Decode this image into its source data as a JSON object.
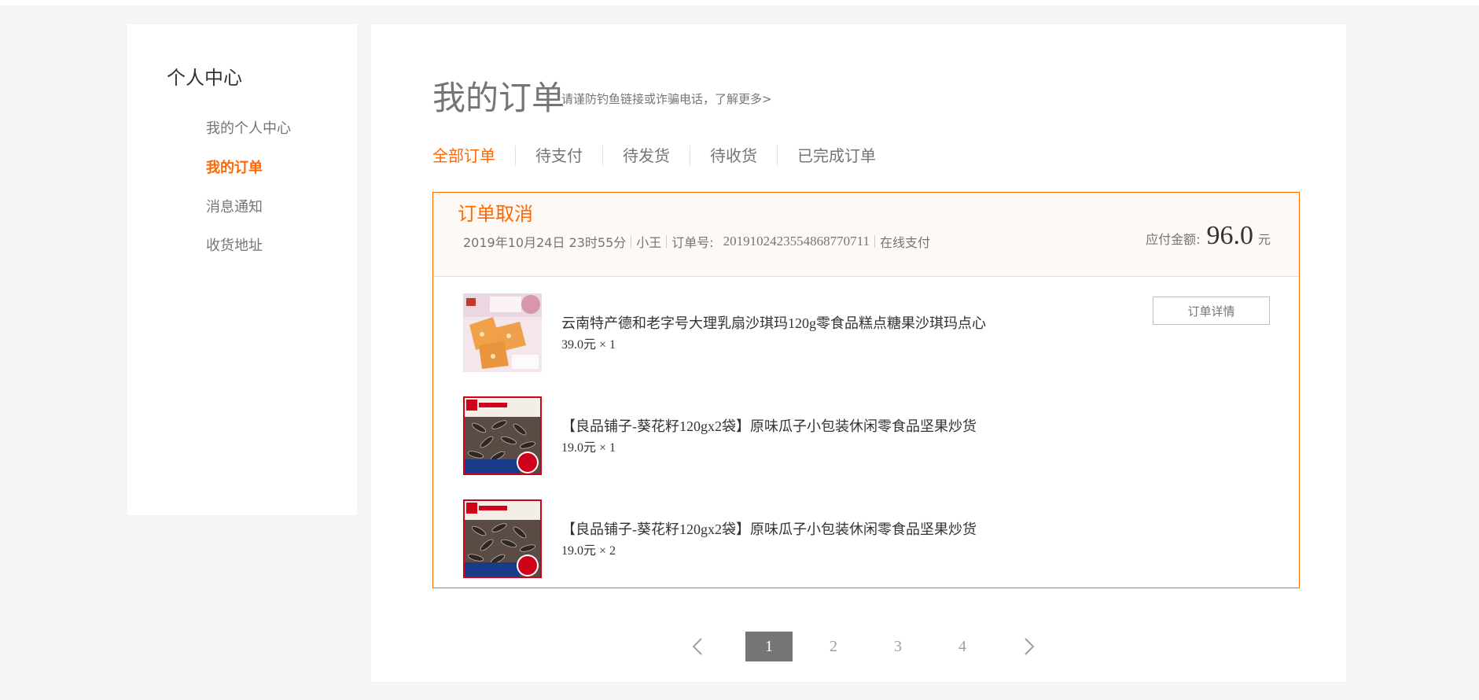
{
  "sidebar": {
    "title": "个人中心",
    "items": [
      {
        "label": "我的个人中心",
        "active": false
      },
      {
        "label": "我的订单",
        "active": true
      },
      {
        "label": "消息通知",
        "active": false
      },
      {
        "label": "收货地址",
        "active": false
      }
    ]
  },
  "main": {
    "title": "我的订单",
    "subtitle": "请谨防钓鱼链接或诈骗电话，了解更多>",
    "tabs": [
      {
        "label": "全部订单",
        "active": true
      },
      {
        "label": "待支付",
        "active": false
      },
      {
        "label": "待发货",
        "active": false
      },
      {
        "label": "待收货",
        "active": false
      },
      {
        "label": "已完成订单",
        "active": false
      }
    ]
  },
  "order": {
    "status": "订单取消",
    "date": "2019年10月24日 23时55分",
    "customer": "小王",
    "order_no_label": "订单号:",
    "order_no": "201910242355486877071​1",
    "payment": "在线支付",
    "amount_label": "应付金额:",
    "amount": "96.0",
    "amount_unit": "元",
    "detail_button": "订单详情",
    "items": [
      {
        "name": "云南特产德和老字号大理乳扇沙琪玛120g零食品糕点糖果沙琪玛点心",
        "price": "39.0元 × 1",
        "thumb": "sachima-thumb"
      },
      {
        "name": "【良品铺子-葵花籽120gx2袋】原味瓜子小包装休闲零食品坚果炒货",
        "price": "19.0元 × 1",
        "thumb": "sunflower-seeds-thumb"
      },
      {
        "name": "【良品铺子-葵花籽120gx2袋】原味瓜子小包装休闲零食品坚果炒货",
        "price": "19.0元 × 2",
        "thumb": "sunflower-seeds-thumb"
      }
    ]
  },
  "pagination": {
    "pages": [
      "1",
      "2",
      "3",
      "4"
    ],
    "current": "1",
    "prev_icon": "chevron-left-icon",
    "next_icon": "chevron-right-icon"
  },
  "colors": {
    "accent": "#ff6700",
    "muted": "#757575",
    "background": "#f5f5f5"
  }
}
